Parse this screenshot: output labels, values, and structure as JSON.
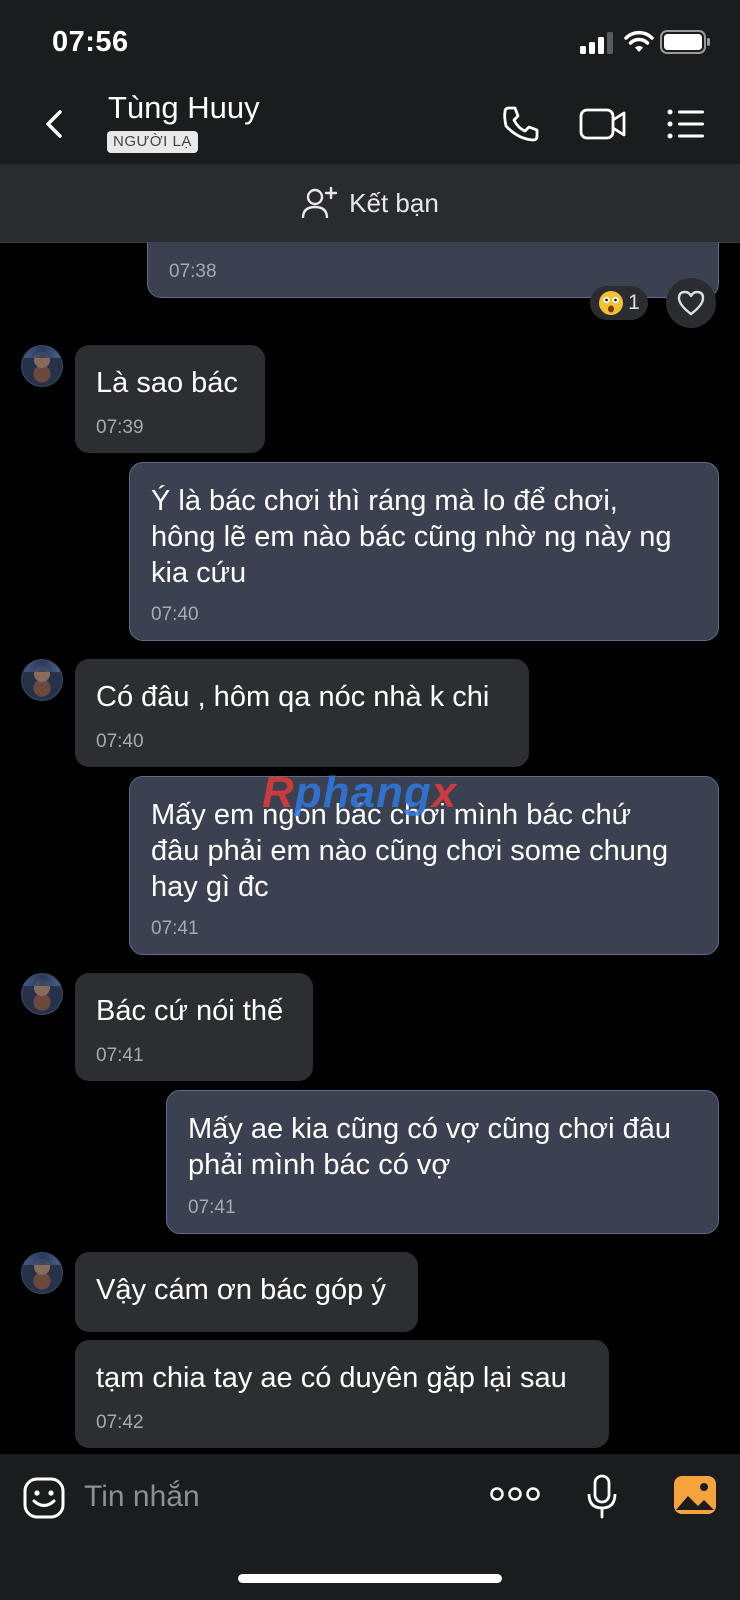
{
  "status_bar": {
    "time": "07:56"
  },
  "header": {
    "name": "Tùng Huuy",
    "badge": "NGƯỜI LẠ"
  },
  "add_friend": {
    "label": "Kết bạn"
  },
  "reaction": {
    "count": "1"
  },
  "watermark": {
    "part1": "R",
    "part2": "phang",
    "part3": "x"
  },
  "messages": [
    {
      "dir": "out",
      "text": "",
      "time": "07:38"
    },
    {
      "dir": "in",
      "text": "Là sao bác",
      "time": "07:39"
    },
    {
      "dir": "out",
      "text": "Ý là bác chơi thì ráng mà lo để chơi,\nhông lẽ em nào bác cũng nhờ ng này ng\nkia cứu",
      "time": "07:40"
    },
    {
      "dir": "in",
      "text": "Có đâu , hôm qa nóc nhà k chi",
      "time": "07:40"
    },
    {
      "dir": "out",
      "text": "Mấy em ngon bác chơi mình bác chứ\nđâu phải em nào cũng chơi some chung\nhay gì đc",
      "time": "07:41"
    },
    {
      "dir": "in",
      "text": "Bác cứ nói thế",
      "time": "07:41"
    },
    {
      "dir": "out",
      "text": "Mấy ae kia cũng có vợ cũng chơi đâu\nphải mình bác có vợ",
      "time": "07:41"
    },
    {
      "dir": "in",
      "text": "Vậy cám ơn bác góp ý",
      "time": ""
    },
    {
      "dir": "in",
      "text": "tạm chia tay ae có duyên gặp lại sau",
      "time": "07:42"
    }
  ],
  "composer": {
    "placeholder": "Tin nhắn"
  },
  "colors": {
    "outgoing_bubble": "#3b4150",
    "outgoing_border": "#5a6e92",
    "incoming_bubble": "#2d2e31",
    "background": "#000000",
    "accent_image": "#f5a33c"
  },
  "icons": [
    "back-arrow-icon",
    "phone-icon",
    "video-call-icon",
    "list-menu-icon",
    "add-friend-icon",
    "shocked-emoji-icon",
    "heart-icon",
    "sticker-icon",
    "more-icon",
    "microphone-icon",
    "image-icon"
  ]
}
